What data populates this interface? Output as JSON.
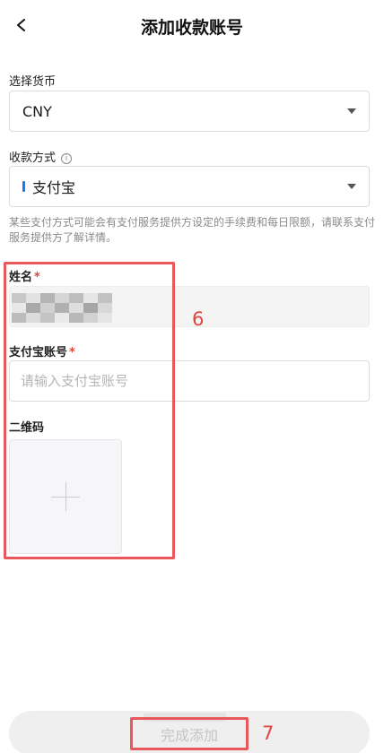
{
  "header": {
    "title": "添加收款账号",
    "back_icon": "chevron-left-icon"
  },
  "currency": {
    "label": "选择货币",
    "value": "CNY"
  },
  "payment_method": {
    "label": "收款方式",
    "info_icon": "i",
    "value": "支付宝"
  },
  "note": "某些支付方式可能会有支付服务提供方设定的手续费和每日限额，请联系支付服务提供方了解详情。",
  "name_field": {
    "label": "姓名",
    "required_mark": "*"
  },
  "account_field": {
    "label": "支付宝账号",
    "required_mark": "*",
    "placeholder": "请输入支付宝账号",
    "value": ""
  },
  "qr_field": {
    "label": "二维码"
  },
  "annotations": {
    "box_6": "6",
    "box_7": "7"
  },
  "submit": {
    "label": "完成添加"
  },
  "colors": {
    "accent_red": "#e0443f",
    "alipay_blue": "#1677ff"
  }
}
